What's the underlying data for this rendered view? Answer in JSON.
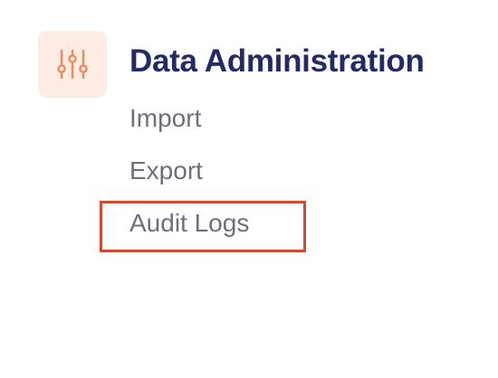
{
  "section": {
    "title": "Data Administration",
    "icon": "sliders-icon",
    "icon_color": "#f08a5d",
    "icon_bg": "#fdece3",
    "title_color": "#232a66"
  },
  "menu": {
    "items": [
      {
        "label": "Import"
      },
      {
        "label": "Export"
      },
      {
        "label": "Audit Logs"
      }
    ],
    "text_color": "#6e6e7e"
  },
  "highlight": {
    "target": "Audit Logs",
    "color": "#d24a30"
  }
}
